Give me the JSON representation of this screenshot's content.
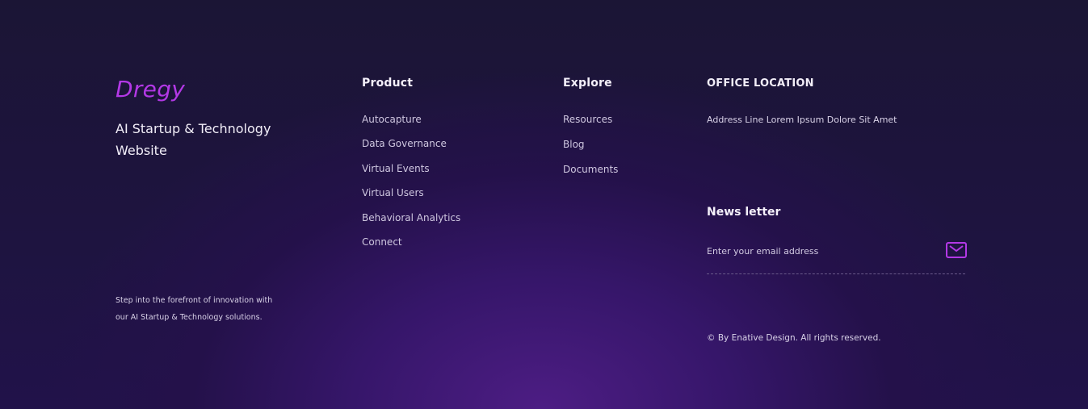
{
  "brand": {
    "name": "Dregy",
    "tagline": "AI Startup & Technology Website",
    "blurb": "Step into the forefront of innovation with our AI Startup & Technology solutions."
  },
  "product": {
    "title": "Product",
    "links": [
      "Autocapture",
      "Data Governance",
      "Virtual Events",
      "Virtual Users",
      "Behavioral Analytics",
      "Connect"
    ]
  },
  "explore": {
    "title": "Explore",
    "links": [
      "Resources",
      "Blog",
      "Documents"
    ]
  },
  "office": {
    "title": "OFFICE LOCATION",
    "address": "Address Line Lorem Ipsum Dolore Sit Amet"
  },
  "newsletter": {
    "title": "News letter",
    "placeholder": "Enter your email address",
    "send_icon": "mail-icon"
  },
  "footer": {
    "copyright": "© By Enative Design. All rights reserved."
  },
  "colors": {
    "accent": "#b338e6",
    "background": "#1e1440"
  }
}
